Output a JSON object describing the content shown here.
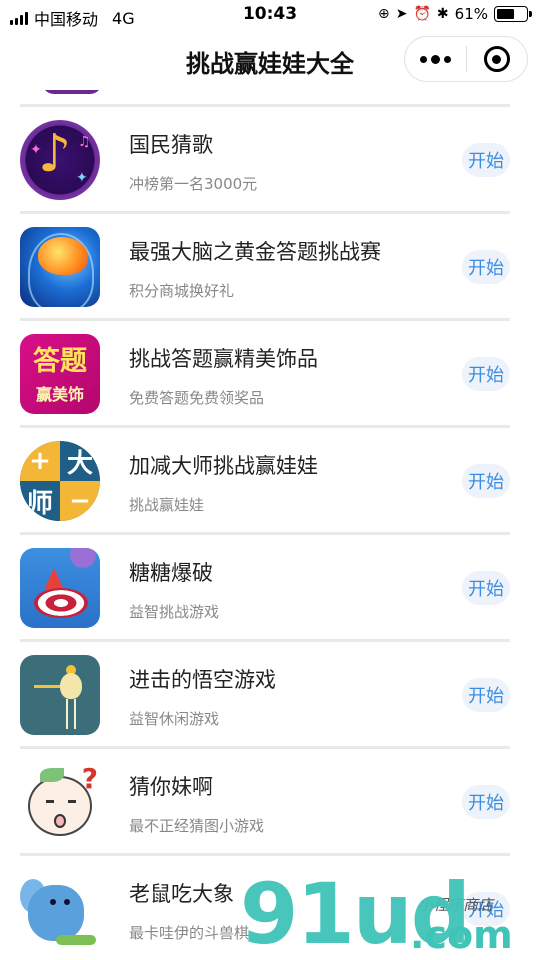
{
  "status_bar": {
    "carrier": "中国移动",
    "network": "4G",
    "time": "10:43",
    "battery": "61%",
    "battery_level": 0.61
  },
  "nav": {
    "title": "挑战赢娃娃大全"
  },
  "start_label": "开始",
  "items": [
    {
      "name": "国民猜歌",
      "desc": "冲榜第一名3000元",
      "icon": "music-note-icon"
    },
    {
      "name": "最强大脑之黄金答题挑战赛",
      "desc": "积分商城换好礼",
      "icon": "brain-icon"
    },
    {
      "name": "挑战答题赢精美饰品",
      "desc": "免费答题免费领奖品",
      "icon": "quiz-icon"
    },
    {
      "name": "加减大师挑战赢娃娃",
      "desc": "挑战赢娃娃",
      "icon": "math-icon"
    },
    {
      "name": "糖糖爆破",
      "desc": "益智挑战游戏",
      "icon": "candy-icon"
    },
    {
      "name": "进击的悟空游戏",
      "desc": "益智休闲游戏",
      "icon": "wukong-icon"
    },
    {
      "name": "猜你妹啊",
      "desc": "最不正经猜图小游戏",
      "icon": "sister-icon"
    },
    {
      "name": "老鼠吃大象",
      "desc": "最卡哇伊的斗兽棋",
      "icon": "elephant-icon"
    }
  ],
  "icon_text": {
    "quiz_line1": "答题",
    "quiz_line2": "赢美饰",
    "math_plus": "+",
    "math_da": "大",
    "math_shi": "师",
    "math_minus": "−"
  },
  "watermark": {
    "main": "91ud",
    "com": ".com",
    "cn": "小程序商店"
  },
  "colors": {
    "accent": "#3b8de0",
    "button_bg": "#eef3fb",
    "divider": "#e9e9e9"
  }
}
